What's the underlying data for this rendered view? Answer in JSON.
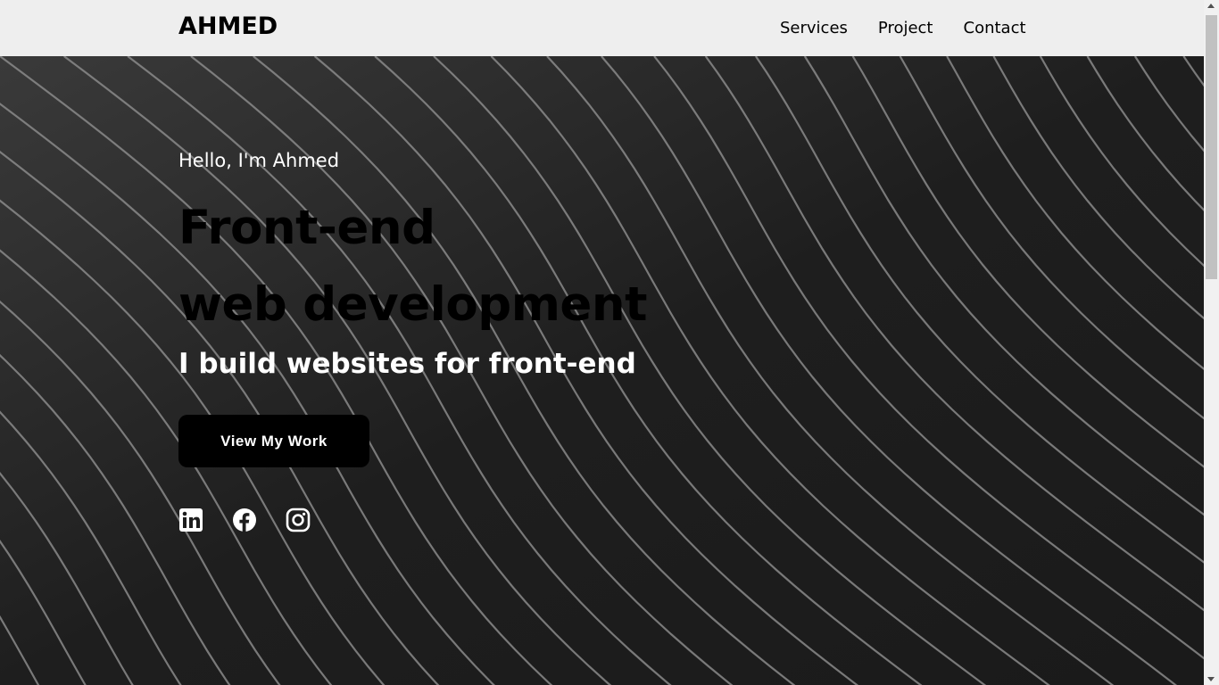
{
  "nav": {
    "logo": "AHMED",
    "links": [
      "Services",
      "Project",
      "Contact"
    ]
  },
  "hero": {
    "greeting": "Hello, I'm Ahmed",
    "headline_line1": "Front-end",
    "headline_line2": "web development",
    "subheading": "I build websites for front-end",
    "cta_label": "View My Work",
    "socials": [
      "linkedin-icon",
      "facebook-icon",
      "instagram-icon"
    ]
  },
  "colors": {
    "nav_bg": "#eeeeee",
    "hero_bg": "#1d1d1d",
    "button_bg": "#000000",
    "text_light": "#ffffff",
    "text_dark": "#000000"
  }
}
